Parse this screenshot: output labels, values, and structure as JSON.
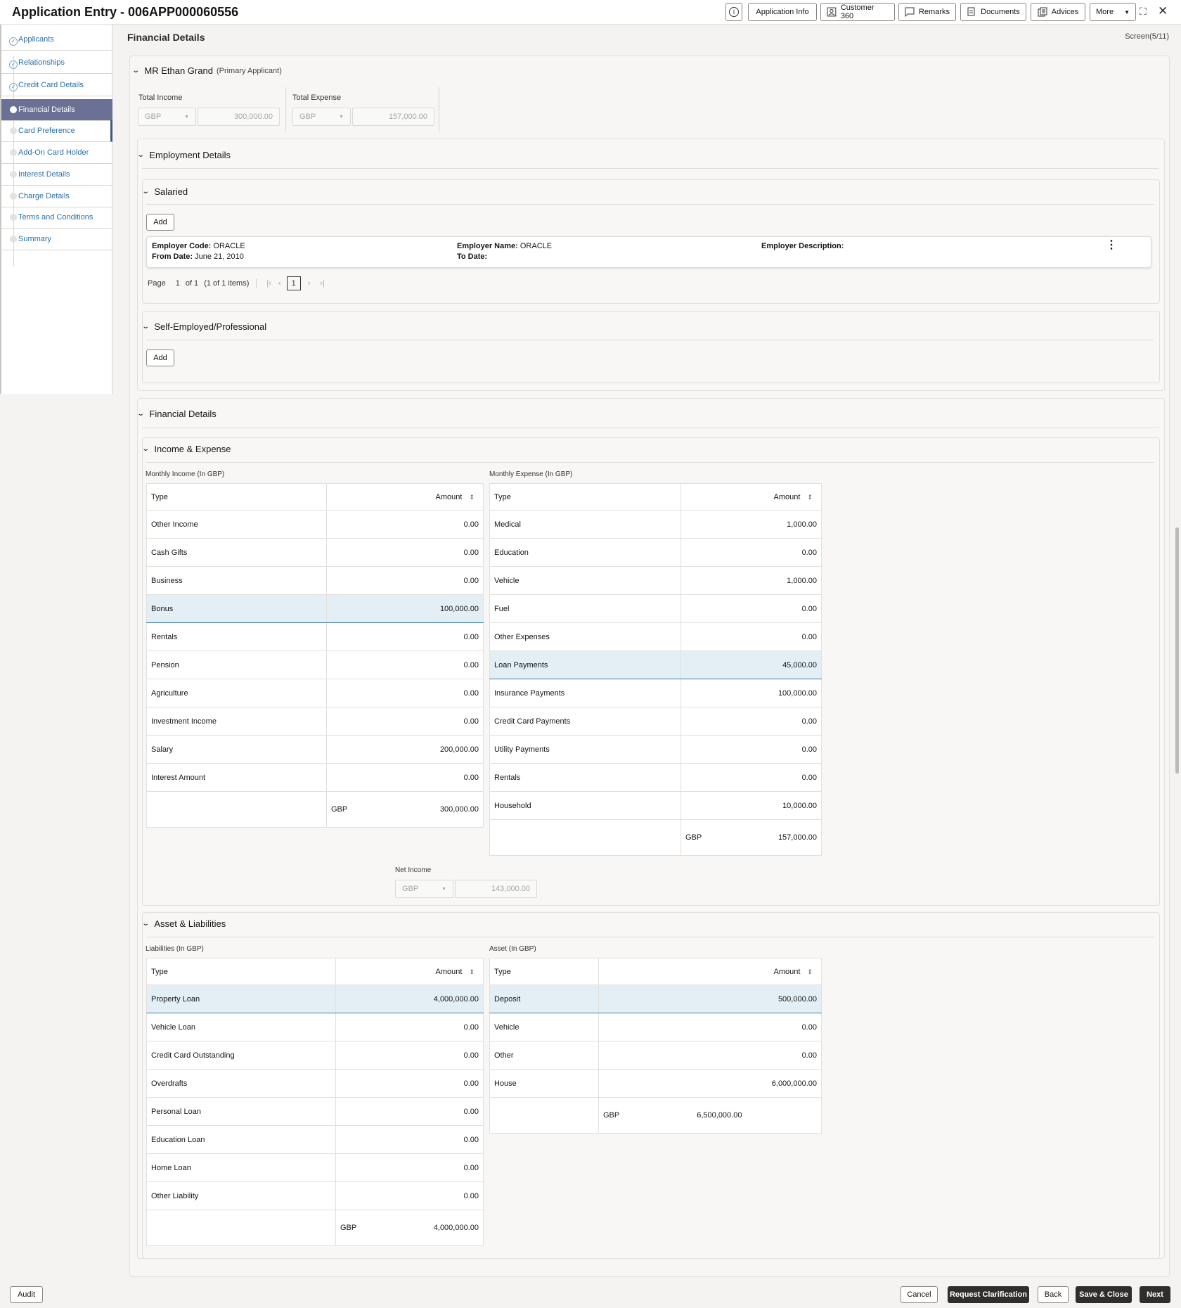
{
  "header": {
    "title": "Application Entry - 006APP000060556",
    "buttons": {
      "info": "i",
      "application_info": "Application Info",
      "customer360": "Customer 360",
      "remarks": "Remarks",
      "documents": "Documents",
      "advices": "Advices",
      "more": "More"
    }
  },
  "sidebar": {
    "items": [
      {
        "label": "Applicants",
        "state": "done"
      },
      {
        "label": "Relationships",
        "state": "done"
      },
      {
        "label": "Credit Card Details",
        "state": "done"
      },
      {
        "label": "Financial Details",
        "state": "active"
      },
      {
        "label": "Card Preference",
        "state": "pending"
      },
      {
        "label": "Add-On Card Holder",
        "state": "pending"
      },
      {
        "label": "Interest Details",
        "state": "pending"
      },
      {
        "label": "Charge Details",
        "state": "pending"
      },
      {
        "label": "Terms and Conditions",
        "state": "pending"
      },
      {
        "label": "Summary",
        "state": "pending"
      }
    ]
  },
  "page": {
    "title": "Financial Details",
    "screen": "Screen(5/11)"
  },
  "applicant": {
    "name": "MR Ethan Grand",
    "role": "(Primary Applicant)",
    "total_income_label": "Total Income",
    "total_income_ccy": "GBP",
    "total_income": "300,000.00",
    "total_expense_label": "Total Expense",
    "total_expense_ccy": "GBP",
    "total_expense": "157,000.00"
  },
  "employment": {
    "title": "Employment Details",
    "salaried": {
      "title": "Salaried",
      "add": "Add",
      "record": {
        "code_label": "Employer Code:",
        "code": "ORACLE",
        "name_label": "Employer Name:",
        "name": "ORACLE",
        "desc_label": "Employer Description:",
        "from_label": "From Date:",
        "from": "June 21, 2010",
        "to_label": "To Date:"
      },
      "pagination": {
        "page_label": "Page",
        "page": "1",
        "of": "of 1",
        "items": "(1 of 1 items)",
        "current": "1"
      }
    },
    "self_employed": {
      "title": "Self-Employed/Professional",
      "add": "Add"
    }
  },
  "financial": {
    "title": "Financial Details",
    "income_expense": {
      "title": "Income & Expense",
      "income": {
        "label": "Monthly Income (In GBP)",
        "col_type": "Type",
        "col_amount": "Amount",
        "rows": [
          {
            "type": "Other Income",
            "amount": "0.00"
          },
          {
            "type": "Cash Gifts",
            "amount": "0.00"
          },
          {
            "type": "Business",
            "amount": "0.00"
          },
          {
            "type": "Bonus",
            "amount": "100,000.00",
            "selected": true
          },
          {
            "type": "Rentals",
            "amount": "0.00"
          },
          {
            "type": "Pension",
            "amount": "0.00"
          },
          {
            "type": "Agriculture",
            "amount": "0.00"
          },
          {
            "type": "Investment Income",
            "amount": "0.00"
          },
          {
            "type": "Salary",
            "amount": "200,000.00"
          },
          {
            "type": "Interest Amount",
            "amount": "0.00"
          }
        ],
        "total_ccy": "GBP",
        "total": "300,000.00"
      },
      "expense": {
        "label": "Monthly Expense (In GBP)",
        "col_type": "Type",
        "col_amount": "Amount",
        "rows": [
          {
            "type": "Medical",
            "amount": "1,000.00"
          },
          {
            "type": "Education",
            "amount": "0.00"
          },
          {
            "type": "Vehicle",
            "amount": "1,000.00"
          },
          {
            "type": "Fuel",
            "amount": "0.00"
          },
          {
            "type": "Other Expenses",
            "amount": "0.00"
          },
          {
            "type": "Loan Payments",
            "amount": "45,000.00",
            "selected": true
          },
          {
            "type": "Insurance Payments",
            "amount": "100,000.00"
          },
          {
            "type": "Credit Card Payments",
            "amount": "0.00"
          },
          {
            "type": "Utility Payments",
            "amount": "0.00"
          },
          {
            "type": "Rentals",
            "amount": "0.00"
          },
          {
            "type": "Household",
            "amount": "10,000.00"
          }
        ],
        "total_ccy": "GBP",
        "total": "157,000.00"
      },
      "net_income_label": "Net Income",
      "net_income_ccy": "GBP",
      "net_income": "143,000.00"
    },
    "asset_liabilities": {
      "title": "Asset & Liabilities",
      "liabilities": {
        "label": "Liabilities (In GBP)",
        "col_type": "Type",
        "col_amount": "Amount",
        "rows": [
          {
            "type": "Property Loan",
            "amount": "4,000,000.00",
            "selected": true
          },
          {
            "type": "Vehicle Loan",
            "amount": "0.00"
          },
          {
            "type": "Credit Card Outstanding",
            "amount": "0.00"
          },
          {
            "type": "Overdrafts",
            "amount": "0.00"
          },
          {
            "type": "Personal Loan",
            "amount": "0.00"
          },
          {
            "type": "Education Loan",
            "amount": "0.00"
          },
          {
            "type": "Home Loan",
            "amount": "0.00"
          },
          {
            "type": "Other Liability",
            "amount": "0.00"
          }
        ],
        "total_ccy": "GBP",
        "total": "4,000,000.00"
      },
      "assets": {
        "label": "Asset (In GBP)",
        "col_type": "Type",
        "col_amount": "Amount",
        "rows": [
          {
            "type": "Deposit",
            "amount": "500,000.00",
            "selected": true
          },
          {
            "type": "Vehicle",
            "amount": "0.00"
          },
          {
            "type": "Other",
            "amount": "0.00"
          },
          {
            "type": "House",
            "amount": "6,000,000.00"
          }
        ],
        "total_ccy": "GBP",
        "total": "6,500,000.00"
      }
    }
  },
  "footer": {
    "audit": "Audit",
    "cancel": "Cancel",
    "request_clarification": "Request Clarification",
    "back": "Back",
    "save_close": "Save & Close",
    "next": "Next"
  }
}
